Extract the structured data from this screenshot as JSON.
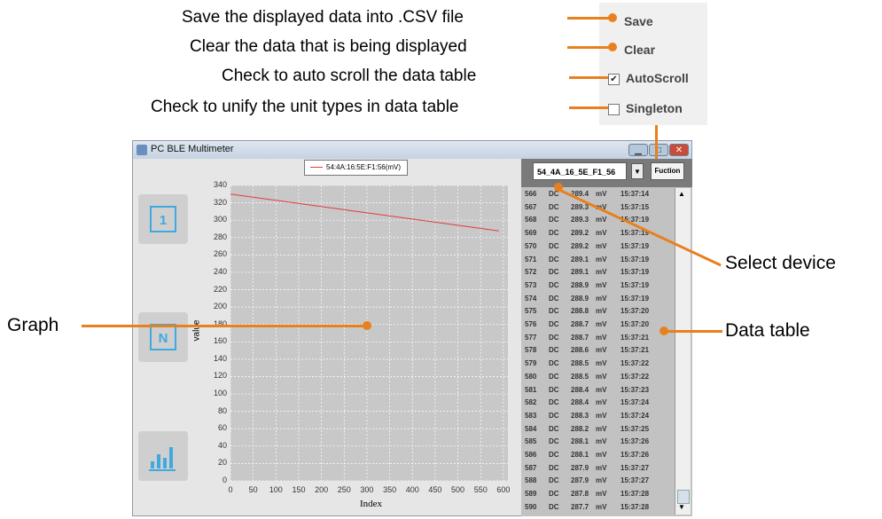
{
  "callouts": {
    "save": "Save the displayed data into .CSV file",
    "clear": "Clear the data that is being displayed",
    "autoscroll": "Check to auto scroll the data table",
    "singleton": "Check to unify the unit types in data table",
    "graph": "Graph",
    "select_device": "Select device",
    "data_table": "Data table"
  },
  "menu": {
    "save": "Save",
    "clear": "Clear",
    "autoscroll": "AutoScroll",
    "autoscroll_checked": true,
    "singleton": "Singleton",
    "singleton_checked": false
  },
  "window": {
    "title": "PC BLE Multimeter",
    "controls": [
      "minimize",
      "maximize",
      "close"
    ]
  },
  "device_select": "54_4A_16_5E_F1_56",
  "function_button": "Fuction",
  "colors": {
    "accent_orange": "#E8801E",
    "plot_bg": "#C8C8C8",
    "series_line": "#E23A3A",
    "side_icon_blue": "#3FA9E0"
  },
  "side_icons": [
    "single-value-icon",
    "n-value-icon",
    "bar-chart-icon"
  ],
  "chart_data": {
    "type": "line",
    "xlabel": "Index",
    "ylabel": "value",
    "xlim": [
      0,
      610
    ],
    "ylim": [
      0,
      340
    ],
    "xticks": [
      0,
      50,
      100,
      150,
      200,
      250,
      300,
      350,
      400,
      450,
      500,
      550,
      600
    ],
    "yticks": [
      0,
      20,
      40,
      60,
      80,
      100,
      120,
      140,
      160,
      180,
      200,
      220,
      240,
      260,
      280,
      300,
      320,
      340
    ],
    "grid": true,
    "legend_position": "top-center",
    "series": [
      {
        "name": "54:4A:16:5E:F1:56(mV)",
        "x": [
          0,
          590
        ],
        "y": [
          330,
          287.7
        ]
      }
    ]
  },
  "table": {
    "rows": [
      [
        "566",
        "DC",
        "289.4",
        "mV",
        "15:37:14"
      ],
      [
        "567",
        "DC",
        "289.3",
        "mV",
        "15:37:15"
      ],
      [
        "568",
        "DC",
        "289.3",
        "mV",
        "15:37:19"
      ],
      [
        "569",
        "DC",
        "289.2",
        "mV",
        "15:37:19"
      ],
      [
        "570",
        "DC",
        "289.2",
        "mV",
        "15:37:19"
      ],
      [
        "571",
        "DC",
        "289.1",
        "mV",
        "15:37:19"
      ],
      [
        "572",
        "DC",
        "289.1",
        "mV",
        "15:37:19"
      ],
      [
        "573",
        "DC",
        "288.9",
        "mV",
        "15:37:19"
      ],
      [
        "574",
        "DC",
        "288.9",
        "mV",
        "15:37:19"
      ],
      [
        "575",
        "DC",
        "288.8",
        "mV",
        "15:37:20"
      ],
      [
        "576",
        "DC",
        "288.7",
        "mV",
        "15:37:20"
      ],
      [
        "577",
        "DC",
        "288.7",
        "mV",
        "15:37:21"
      ],
      [
        "578",
        "DC",
        "288.6",
        "mV",
        "15:37:21"
      ],
      [
        "579",
        "DC",
        "288.5",
        "mV",
        "15:37:22"
      ],
      [
        "580",
        "DC",
        "288.5",
        "mV",
        "15:37:22"
      ],
      [
        "581",
        "DC",
        "288.4",
        "mV",
        "15:37:23"
      ],
      [
        "582",
        "DC",
        "288.4",
        "mV",
        "15:37:24"
      ],
      [
        "583",
        "DC",
        "288.3",
        "mV",
        "15:37:24"
      ],
      [
        "584",
        "DC",
        "288.2",
        "mV",
        "15:37:25"
      ],
      [
        "585",
        "DC",
        "288.1",
        "mV",
        "15:37:26"
      ],
      [
        "586",
        "DC",
        "288.1",
        "mV",
        "15:37:26"
      ],
      [
        "587",
        "DC",
        "287.9",
        "mV",
        "15:37:27"
      ],
      [
        "588",
        "DC",
        "287.9",
        "mV",
        "15:37:27"
      ],
      [
        "589",
        "DC",
        "287.8",
        "mV",
        "15:37:28"
      ],
      [
        "590",
        "DC",
        "287.7",
        "mV",
        "15:37:28"
      ]
    ]
  }
}
